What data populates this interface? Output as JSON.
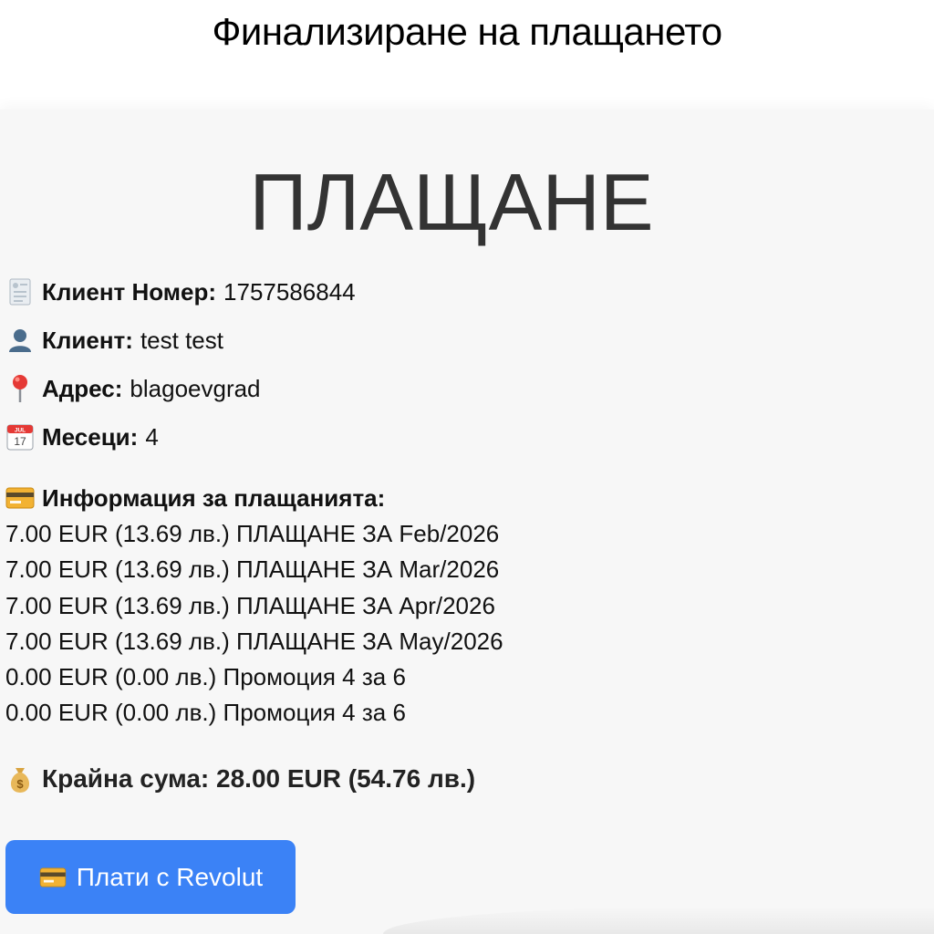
{
  "header": {
    "title": "Финализиране на плащането"
  },
  "card": {
    "title": "ПЛАЩАНЕ",
    "client_number": {
      "icon": "receipt-icon",
      "label": "Клиент Номер:",
      "value": "1757586844"
    },
    "client": {
      "icon": "user-icon",
      "label": "Клиент:",
      "value": "test test"
    },
    "address": {
      "icon": "map-pin-icon",
      "label": "Адрес:",
      "value": "blagoevgrad"
    },
    "months": {
      "icon": "calendar-icon",
      "label": "Месеци:",
      "value": "4",
      "calendar_badge": "JUL",
      "calendar_day": "17"
    },
    "payments": {
      "icon": "credit-card-icon",
      "heading": "Информация за плащанията:",
      "lines": [
        "7.00 EUR (13.69 лв.) ПЛАЩАНЕ ЗА Feb/2026",
        "7.00 EUR (13.69 лв.) ПЛАЩАНЕ ЗА Mar/2026",
        "7.00 EUR (13.69 лв.) ПЛАЩАНЕ ЗА Apr/2026",
        "7.00 EUR (13.69 лв.) ПЛАЩАНЕ ЗА May/2026",
        "0.00 EUR (0.00 лв.) Промоция 4 за 6",
        "0.00 EUR (0.00 лв.) Промоция 4 за 6"
      ]
    },
    "total": {
      "icon": "money-bag-icon",
      "text": "Крайна сума: 28.00 EUR (54.76 лв.)"
    },
    "pay_button": {
      "icon": "credit-card-icon",
      "label": "Плати с Revolut"
    }
  },
  "colors": {
    "button": "#3b82f6",
    "card_background": "#f7f7f7",
    "title": "#333333"
  }
}
